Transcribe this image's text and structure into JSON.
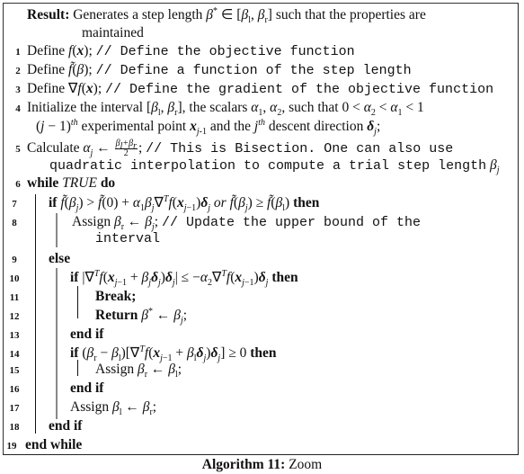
{
  "algorithm": {
    "caption_label": "Algorithm 11:",
    "caption_title": "Zoom",
    "result_label": "Result:",
    "result_text_1": "Generates a step length β* ∈ [βl, βr] such that the properties are",
    "result_text_2": "maintained",
    "lines": [
      {
        "num": "1",
        "kw": "Define",
        "math": "f(x);",
        "comment": "// Define the objective function"
      },
      {
        "num": "2",
        "kw": "Define",
        "math": "f̃(β);",
        "comment": "// Define a function of the step length"
      },
      {
        "num": "3",
        "kw": "Define",
        "math": "∇f(x);",
        "comment": "// Define the gradient of the objective function"
      },
      {
        "num": "4",
        "text_1": "Initialize the interval [βl, βr], the scalars α1, α2, such that 0 < α2 < α1 < 1",
        "text_2": "(j − 1)th experimental point xj−1 and the jth descent direction δj;"
      },
      {
        "num": "5",
        "kw": "Calculate",
        "math": "αj ← (βl+βr)/2;",
        "comment_1": "// This is Bisection.  One can also use",
        "comment_2": "quadratic interpolation to compute a trial step length βj"
      },
      {
        "num": "6",
        "kw": "while",
        "cond": "TRUE",
        "kw2": "do"
      },
      {
        "num": "7",
        "kw": "if",
        "cond": "f̃(βj) > f̃(0) + α1βj∇ᵀf(xj−1)δj or f̃(βj) ≥ f̃(βl)",
        "kw2": "then"
      },
      {
        "num": "8",
        "kw": "Assign",
        "math": "βr ← βj;",
        "comment_1": "// Update the upper bound of the",
        "comment_2": "interval"
      },
      {
        "num": "9",
        "kw": "else"
      },
      {
        "num": "10",
        "kw": "if",
        "cond": "|∇ᵀf(xj−1 + βjδj)δj| ≤ −α2∇ᵀf(xj−1)δj",
        "kw2": "then"
      },
      {
        "num": "11",
        "kw": "Break;"
      },
      {
        "num": "12",
        "kw": "Return",
        "math": "β* ← βj;"
      },
      {
        "num": "13",
        "kw": "end if"
      },
      {
        "num": "14",
        "kw": "if",
        "cond": "(βr − βl)[∇ᵀf(xj−1 + βlδj)δj] ≥ 0",
        "kw2": "then"
      },
      {
        "num": "15",
        "kw": "Assign",
        "math": "βr ← βl;"
      },
      {
        "num": "16",
        "kw": "end if"
      },
      {
        "num": "17",
        "kw": "Assign",
        "math": "βl ← βr;"
      },
      {
        "num": "18",
        "kw": "end if"
      },
      {
        "num": "19",
        "kw": "end while"
      }
    ]
  }
}
